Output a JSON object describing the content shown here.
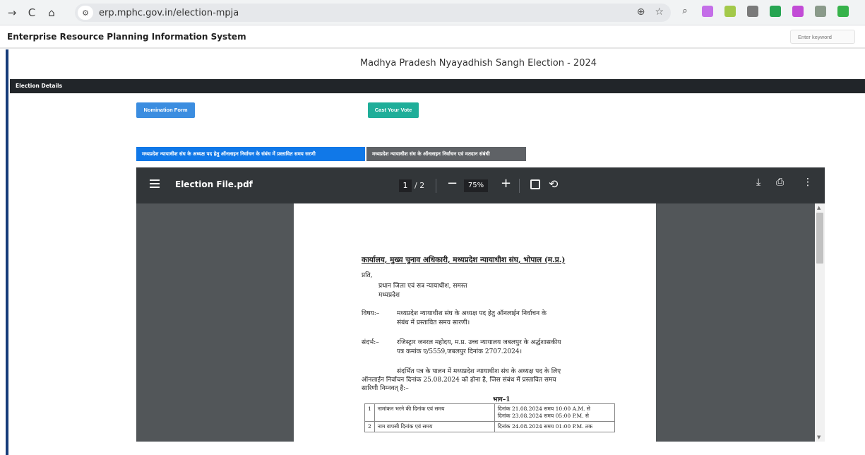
{
  "browser": {
    "url": "erp.mphc.gov.in/election-mpja",
    "icons": [
      "back-arrow-icon",
      "reload-icon",
      "home-icon",
      "site-info-icon",
      "zoom-icon",
      "bookmark-star-icon",
      "search-icon"
    ],
    "extensions": [
      "extension-1-icon",
      "extension-2-icon",
      "extension-3-icon",
      "extension-4-icon",
      "extension-5-icon",
      "extension-6-icon",
      "extension-7-icon"
    ]
  },
  "header": {
    "site_title": "Enterprise Resource Planning Information System",
    "keyword_placeholder": "Enter keyword"
  },
  "page": {
    "heading": "Madhya Pradesh Nyayadhish Sangh Election - 2024",
    "section_label": "Election Details",
    "nomination_button": "Nomination Form",
    "vote_button": "Cast Your Vote",
    "tabs": [
      {
        "label": "मध्यप्रदेश न्यायाधीश संघ के अध्यक्ष पद हेतु ऑनलाइन निर्वाचन के संबंध में प्रस्तावित समय सरणी",
        "active": true
      },
      {
        "label": "मध्यप्रदेश न्यायाधीश संघ के ऑनलाइन निर्वाचन एवं मतदान संबंधी",
        "active": false
      }
    ]
  },
  "pdf_viewer": {
    "filename": "Election File.pdf",
    "current_page": "1",
    "total_pages": "/ 2",
    "zoom": "75%",
    "document": {
      "title": "कार्यालय, मुख्य चुनाव अधिकारी, मध्यप्रदेश न्यायाधीश संघ, भोपाल (म.प्र.)",
      "prati": "प्रति,",
      "recipient_1": "प्रधान जिला एवं सत्र न्यायाधीश, समस्त",
      "recipient_2": "मध्यप्रदेश",
      "vishay_label": "विषय:–",
      "vishay_1": "मध्यप्रदेश न्यायाधीश संघ के अध्यक्ष पद हेतु ऑनलाईन निर्वाचन के",
      "vishay_2": "संबंध में प्रस्तावित समय सारणी।",
      "sandarbh_label": "संदर्भ:–",
      "sandarbh_1": "रजिस्ट्रार जनरल महोदय, म.प्र. उच्च न्यायालय जबलपुर के अर्द्धशासकीय",
      "sandarbh_2": "पत्र कमांक ए/5559,जबलपुर दिनांक 2707.2024।",
      "body_1": "संदर्भित पत्र के पालन में मध्यप्रदेश न्यायाधीश संघ के अध्यक्ष पद के लिए",
      "body_2": "ऑनलाईन निर्वाचन दिनांक 25.08.2024 को होना है, जिस संबंध में प्रस्तावित समय",
      "body_3": "सारिणी निम्नवत् है:–",
      "part": "भाग–1",
      "table": [
        {
          "no": "1",
          "item": "नामांकन भरने की दिनांक एवं समय",
          "detail_1": "दिनांक 21.08.2024 समय 10:00 A.M. से",
          "detail_2": "दिनांक 23.08.2024 समय 05:00 P.M. से"
        },
        {
          "no": "2",
          "item": "नाम वापसी दिनांक एवं समय",
          "detail_1": "दिनांक 24.08.2024 समय 01:00 P.M. तक",
          "detail_2": ""
        }
      ]
    }
  }
}
